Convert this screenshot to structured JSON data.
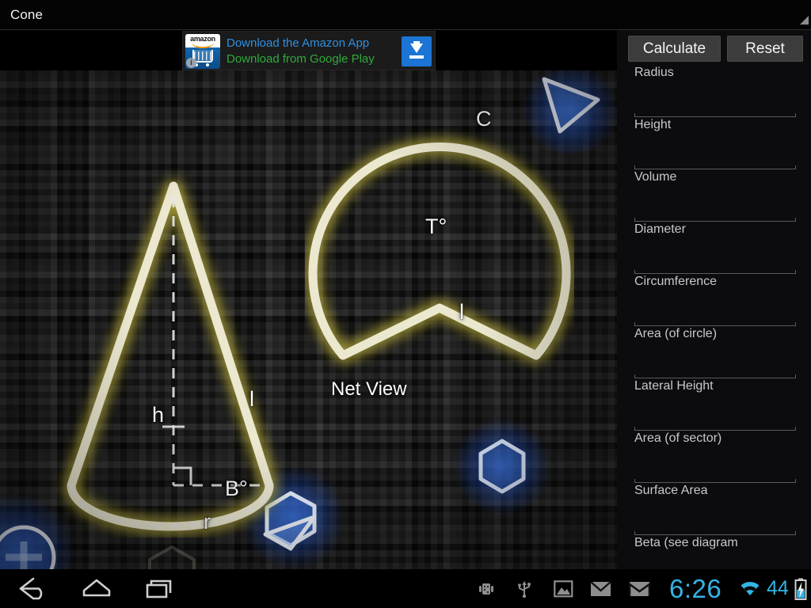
{
  "titlebar": {
    "title": "Cone",
    "overflow_icon": "overflow-triangle-icon"
  },
  "ad": {
    "brand": "amazon",
    "line1": "Download the Amazon App",
    "line2": "Download from Google Play",
    "info_badge": "i",
    "cta_icon": "download-arrow-icon",
    "colors": {
      "line1": "#2f8fe0",
      "line2": "#2faa3c",
      "cta": "#1c74d4"
    }
  },
  "canvas": {
    "cone": {
      "labels": {
        "height": "h",
        "slant": "l",
        "radius": "r",
        "beta": "B°"
      }
    },
    "net": {
      "caption": "Net View",
      "labels": {
        "arc": "C",
        "theta": "T°",
        "slant": "l"
      }
    },
    "shape_color": "#ece8cf",
    "glow_color": "#8f8a3c",
    "accent_blue": "#3c78eb"
  },
  "panel": {
    "buttons": {
      "calculate": "Calculate",
      "reset": "Reset"
    },
    "fields": [
      {
        "label": "Radius",
        "value": ""
      },
      {
        "label": "Height",
        "value": ""
      },
      {
        "label": "Volume",
        "value": ""
      },
      {
        "label": "Diameter",
        "value": ""
      },
      {
        "label": "Circumference",
        "value": ""
      },
      {
        "label": "Area (of circle)",
        "value": ""
      },
      {
        "label": "Lateral Height",
        "value": ""
      },
      {
        "label": "Area (of sector)",
        "value": ""
      },
      {
        "label": "Surface Area",
        "value": ""
      },
      {
        "label": "Beta (see diagram",
        "value": ""
      }
    ]
  },
  "navbar": {
    "back": "back-icon",
    "home": "home-icon",
    "recents": "recents-icon"
  },
  "statusbar": {
    "icons": [
      "android-debug-icon",
      "usb-icon",
      "image-icon",
      "mail-icon",
      "gmail-icon",
      "wifi-icon"
    ],
    "time": "6:26",
    "battery": "44",
    "battery_icon": "battery-charging-icon",
    "accent": "#33b5e5"
  }
}
